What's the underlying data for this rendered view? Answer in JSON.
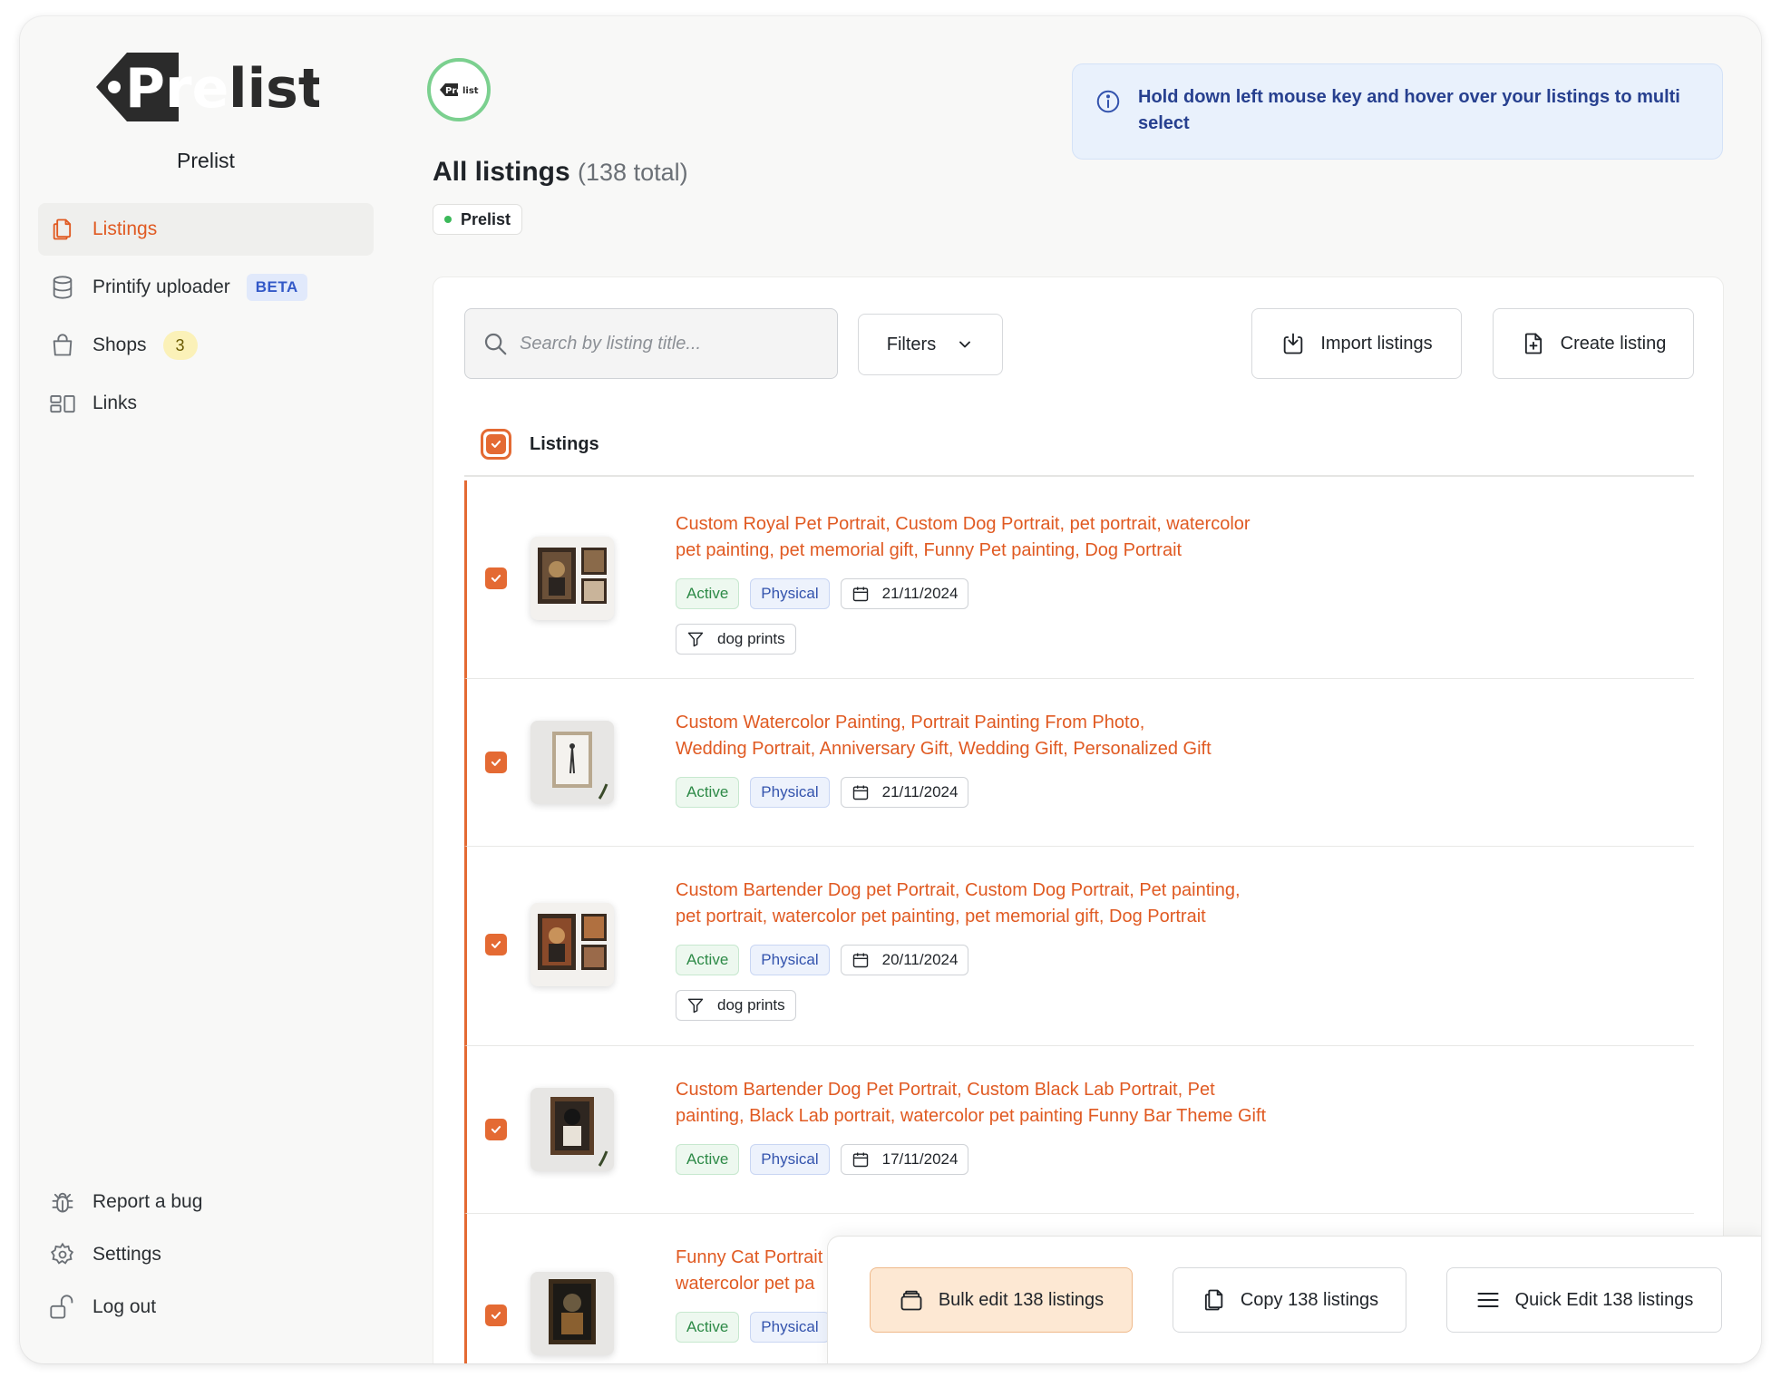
{
  "app": {
    "logo_text": "Prelist",
    "org_name": "Prelist"
  },
  "sidebar": {
    "items": [
      {
        "label": "Listings",
        "icon": "documents-icon",
        "active": true
      },
      {
        "label": "Printify uploader",
        "icon": "database-icon",
        "badge": "BETA"
      },
      {
        "label": "Shops",
        "icon": "shopping-bag-icon",
        "count": "3"
      },
      {
        "label": "Links",
        "icon": "links-icon"
      }
    ],
    "bottom": [
      {
        "label": "Report a bug",
        "icon": "bug-icon"
      },
      {
        "label": "Settings",
        "icon": "gear-icon"
      },
      {
        "label": "Log out",
        "icon": "unlock-icon"
      }
    ]
  },
  "header": {
    "avatar_text": "Prelist",
    "title": "All listings",
    "total": "(138 total)",
    "shop_chip": "Prelist",
    "info": "Hold down left mouse key and hover over your listings to multi select"
  },
  "toolbar": {
    "search_placeholder": "Search by listing title...",
    "filters_label": "Filters",
    "import_label": "Import listings",
    "create_label": "Create listing"
  },
  "list": {
    "header_label": "Listings",
    "rows": [
      {
        "title_line1": "Custom Royal Pet Portrait, Custom Dog Portrait, pet portrait, watercolor",
        "title_line2": "pet painting, pet memorial gift, Funny Pet painting, Dog Portrait",
        "status": "Active",
        "type": "Physical",
        "date": "21/11/2024",
        "section": "dog prints"
      },
      {
        "title_line1": "Custom Watercolor Painting, Portrait Painting From Photo,",
        "title_line2": "Wedding Portrait, Anniversary Gift, Wedding Gift, Personalized Gift",
        "status": "Active",
        "type": "Physical",
        "date": "21/11/2024"
      },
      {
        "title_line1": "Custom Bartender Dog pet Portrait, Custom Dog Portrait, Pet painting,",
        "title_line2": "pet portrait, watercolor pet painting, pet memorial gift, Dog Portrait",
        "status": "Active",
        "type": "Physical",
        "date": "20/11/2024",
        "section": "dog prints"
      },
      {
        "title_line1": "Custom Bartender Dog Pet Portrait, Custom Black Lab Portrait, Pet",
        "title_line2": "painting, Black Lab portrait, watercolor pet painting Funny Bar Theme Gift",
        "status": "Active",
        "type": "Physical",
        "date": "17/11/2024"
      },
      {
        "title_line1": "Funny Cat Portrait",
        "title_line2": "watercolor pet pa",
        "status": "Active",
        "type": "Physical"
      }
    ]
  },
  "bulk_bar": {
    "bulk_edit": "Bulk edit 138 listings",
    "copy": "Copy 138 listings",
    "quick_edit": "Quick Edit 138 listings"
  },
  "colors": {
    "accent": "#e05a22",
    "active_green": "#2d8a47",
    "physical_blue": "#3353ad",
    "info_blue": "#27408f"
  }
}
